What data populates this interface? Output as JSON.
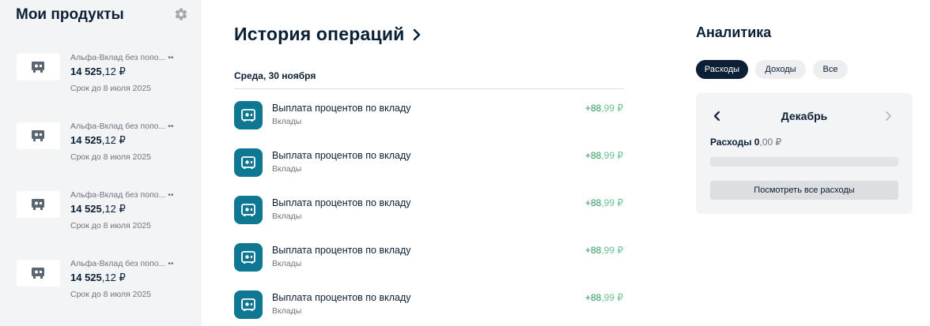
{
  "sidebar": {
    "title": "Мои продукты",
    "settings_icon": "gear-icon",
    "products": [
      {
        "name": "Альфа-Вклад без попо... ••",
        "amount_int": "14 525",
        "amount_frac": ",12 ₽",
        "term": "Срок до 8 июля 2025",
        "icon": "safe-icon"
      },
      {
        "name": "Альфа-Вклад без попо... ••",
        "amount_int": "14 525",
        "amount_frac": ",12 ₽",
        "term": "Срок до 8 июля 2025",
        "icon": "safe-icon"
      },
      {
        "name": "Альфа-Вклад без попо... ••",
        "amount_int": "14 525",
        "amount_frac": ",12 ₽",
        "term": "Срок до 8 июля 2025",
        "icon": "safe-icon"
      },
      {
        "name": "Альфа-Вклад без попо... ••",
        "amount_int": "14 525",
        "amount_frac": ",12 ₽",
        "term": "Срок до 8 июля 2025",
        "icon": "safe-icon"
      }
    ]
  },
  "history": {
    "title": "История операций",
    "arrow_icon": "chevron-right-icon",
    "date": "Среда, 30 ноября",
    "operations": [
      {
        "title": "Выплата процентов по вкладу",
        "category": "Вклады",
        "amount_int": "+88",
        "amount_frac": ",99 ₽",
        "icon": "safe-icon"
      },
      {
        "title": "Выплата процентов по вкладу",
        "category": "Вклады",
        "amount_int": "+88",
        "amount_frac": ",99 ₽",
        "icon": "safe-icon"
      },
      {
        "title": "Выплата процентов по вкладу",
        "category": "Вклады",
        "amount_int": "+88",
        "amount_frac": ",99 ₽",
        "icon": "safe-icon"
      },
      {
        "title": "Выплата процентов по вкладу",
        "category": "Вклады",
        "amount_int": "+88",
        "amount_frac": ",99 ₽",
        "icon": "safe-icon"
      },
      {
        "title": "Выплата процентов по вкладу",
        "category": "Вклады",
        "amount_int": "+88",
        "amount_frac": ",99 ₽",
        "icon": "safe-icon"
      }
    ]
  },
  "analytics": {
    "title": "Аналитика",
    "tabs": [
      {
        "label": "Расходы",
        "active": true
      },
      {
        "label": "Доходы",
        "active": false
      },
      {
        "label": "Все",
        "active": false
      }
    ],
    "month": "Декабрь",
    "expenses_label": "Расходы",
    "expenses_int": "0",
    "expenses_frac": ",00 ₽",
    "expenses_progress": 0,
    "view_all": "Посмотреть все расходы",
    "colors": {
      "accent": "#0b1f35",
      "icon_bg": "#0e7893",
      "income": "#2a9c5a"
    }
  }
}
